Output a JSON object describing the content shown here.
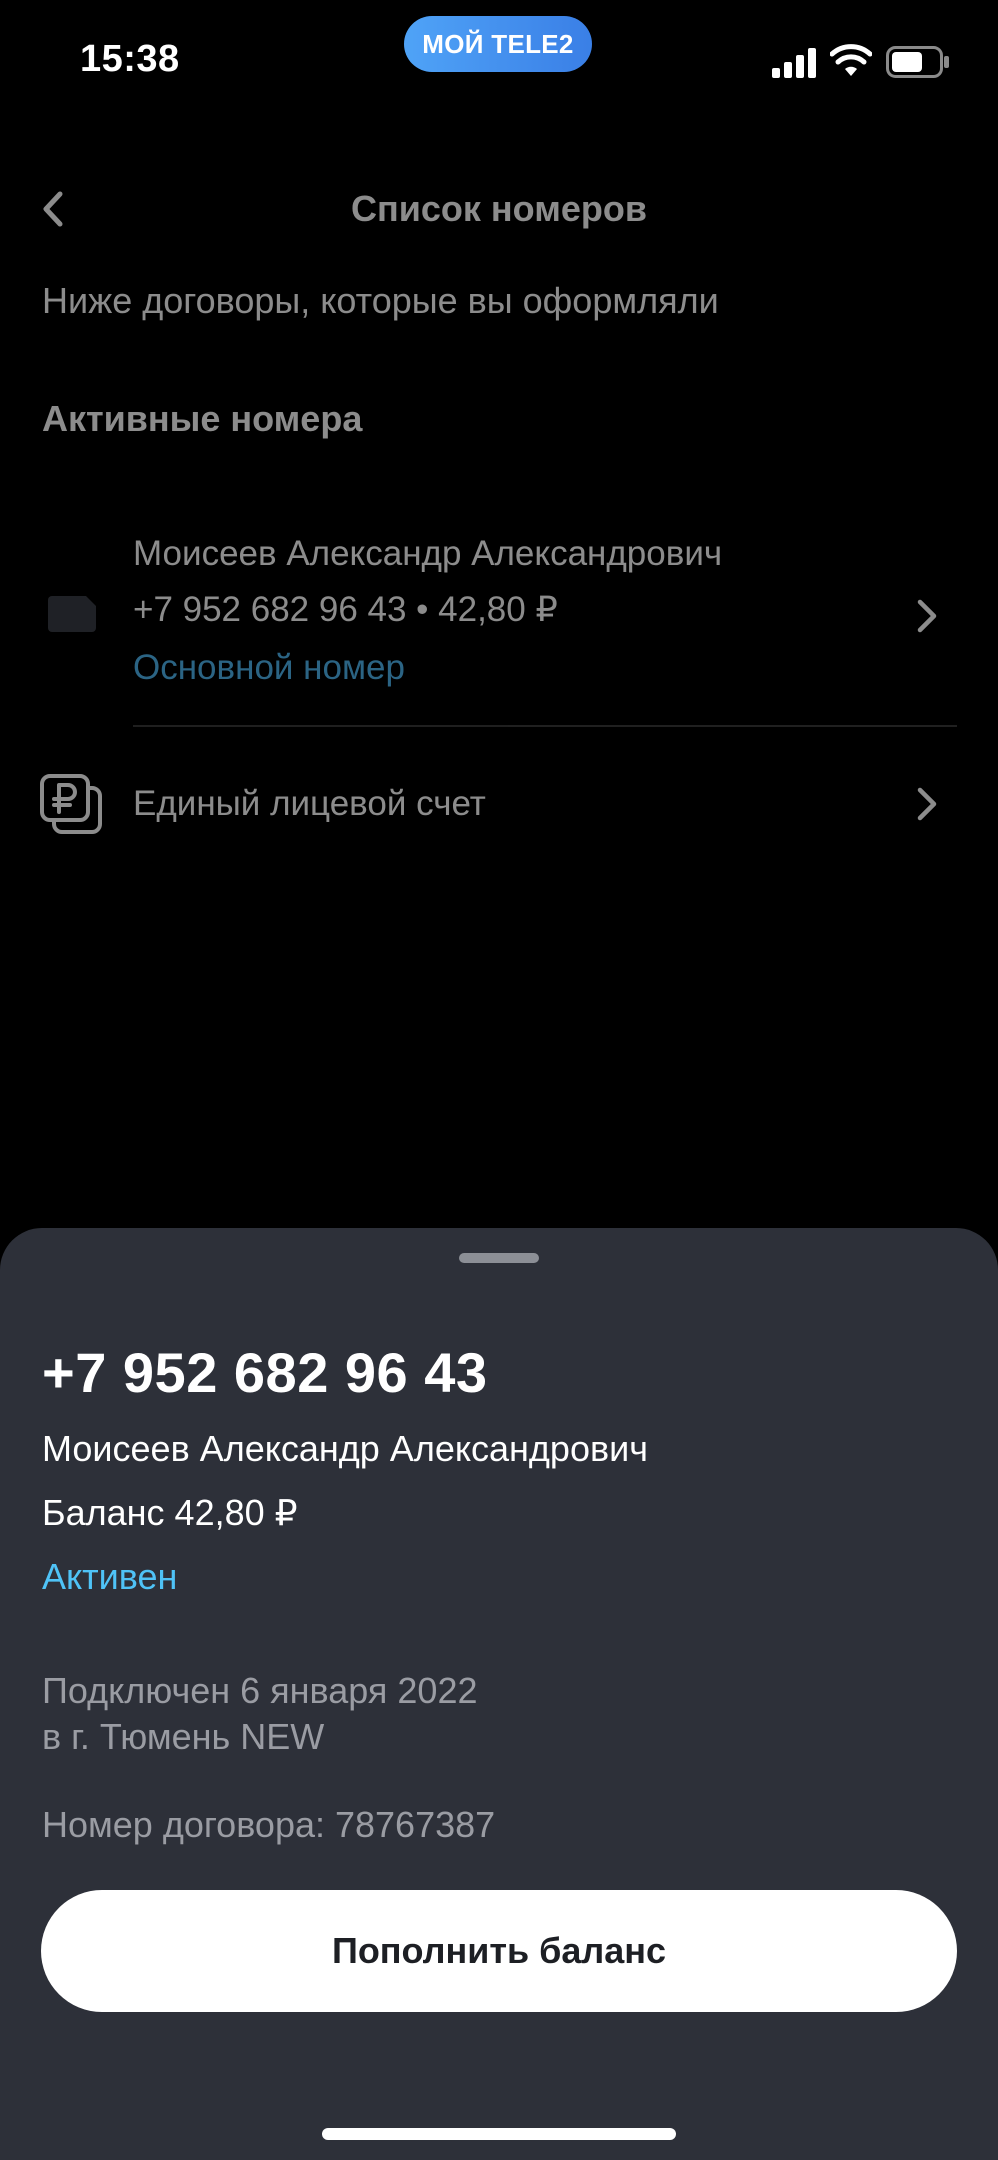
{
  "status_bar": {
    "time": "15:38",
    "carrier_label": "МОЙ TELE2",
    "icons": [
      "signal-icon",
      "wifi-icon",
      "battery-icon"
    ]
  },
  "header": {
    "title": "Список номеров",
    "back_icon": "chevron-left-icon"
  },
  "main": {
    "subtitle": "Ниже договоры, которые вы оформляли",
    "section_title": "Активные номера",
    "number_row": {
      "owner": "Моисеев Александр Александрович",
      "details": "+7 952 682 96 43 • 42,80 ₽",
      "tag": "Основной номер"
    },
    "account_row": {
      "label": "Единый лицевой счет"
    }
  },
  "sheet": {
    "phone_number": "+7 952 682 96 43",
    "owner_name": "Моисеев Александр Александрович",
    "balance": "Баланс 42,80 ₽",
    "status": "Активен",
    "connected_line1": "Подключен 6 января 2022",
    "connected_line2": "в г. Тюмень NEW",
    "contract_number": "Номер договора: 78767387",
    "topup_button_label": "Пополнить баланс"
  },
  "colors": {
    "background": "#000000",
    "sheet": "#2d3039",
    "accent": "#4fc3f7",
    "secondary_text": "#9a9ca3",
    "button": "#ffffff"
  }
}
